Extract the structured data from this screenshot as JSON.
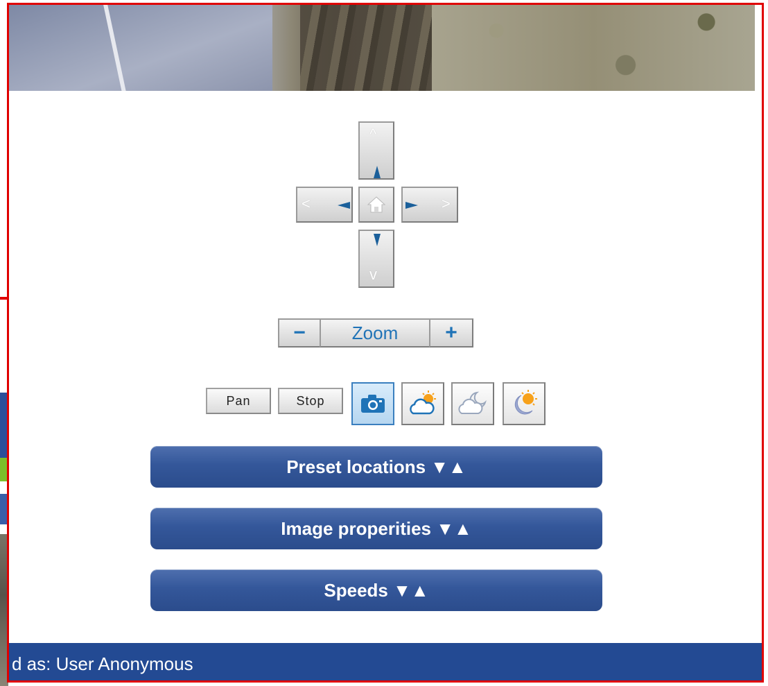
{
  "camera": {
    "ptz": {
      "up_label": "^",
      "down_label": "v",
      "left_label": "<",
      "right_label": ">",
      "home_icon": "home-icon"
    },
    "zoom": {
      "minus_label": "−",
      "label": "Zoom",
      "plus_label": "+"
    },
    "toolbar": {
      "pan_label": "Pan",
      "stop_label": "Stop",
      "icons": [
        "camera-icon",
        "cloudy-day-icon",
        "cloudy-night-icon",
        "moon-sun-icon"
      ]
    },
    "panels": [
      {
        "label": "Preset locations ▼▲"
      },
      {
        "label": "Image properities ▼▲"
      },
      {
        "label": "Speeds ▼▲"
      }
    ]
  },
  "status": {
    "text": "d as: User Anonymous"
  },
  "colors": {
    "accent": "#1f73b7",
    "panel": "#2b4c8c",
    "status_bar": "#234a93",
    "frame": "#e00000"
  }
}
